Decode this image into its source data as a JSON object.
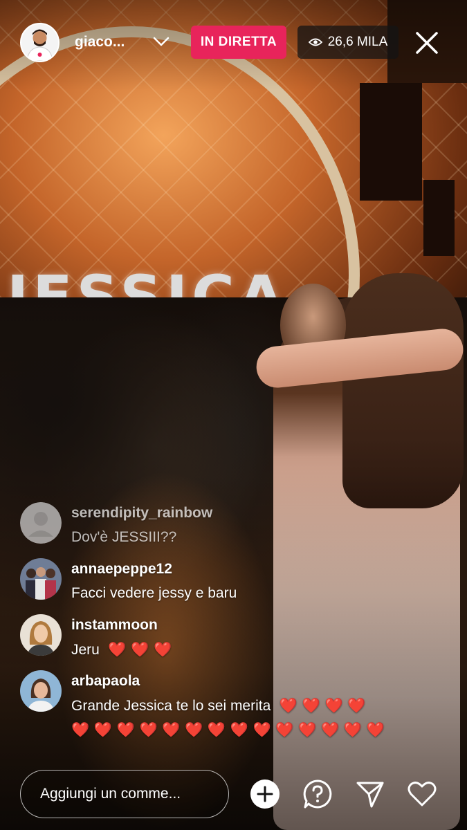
{
  "header": {
    "username": "giaco...",
    "live_label": "IN DIRETTA",
    "viewer_count": "26,6 MILA"
  },
  "video": {
    "backdrop_text": "JESSICA"
  },
  "comments": [
    {
      "user": "serendipity_rainbow",
      "text": "Dov'è JESSIII??",
      "avatar": "default-avatar-icon"
    },
    {
      "user": "annaepeppe12",
      "text": "Facci vedere jessy e baru",
      "avatar": "photo"
    },
    {
      "user": "instammoon",
      "text": "Jeru",
      "hearts": 3,
      "avatar": "photo"
    },
    {
      "user": "arbapaola",
      "text": "Grande Jessica te lo sei merita",
      "hearts_line1": 4,
      "hearts_line2": 14,
      "avatar": "photo"
    }
  ],
  "footer": {
    "comment_placeholder": "Aggiungi un comme...",
    "icons": [
      "add-icon",
      "question-icon",
      "send-icon",
      "heart-icon"
    ]
  },
  "colors": {
    "live_badge": "#e8245b",
    "heart_emoji": "#e23b2e"
  }
}
